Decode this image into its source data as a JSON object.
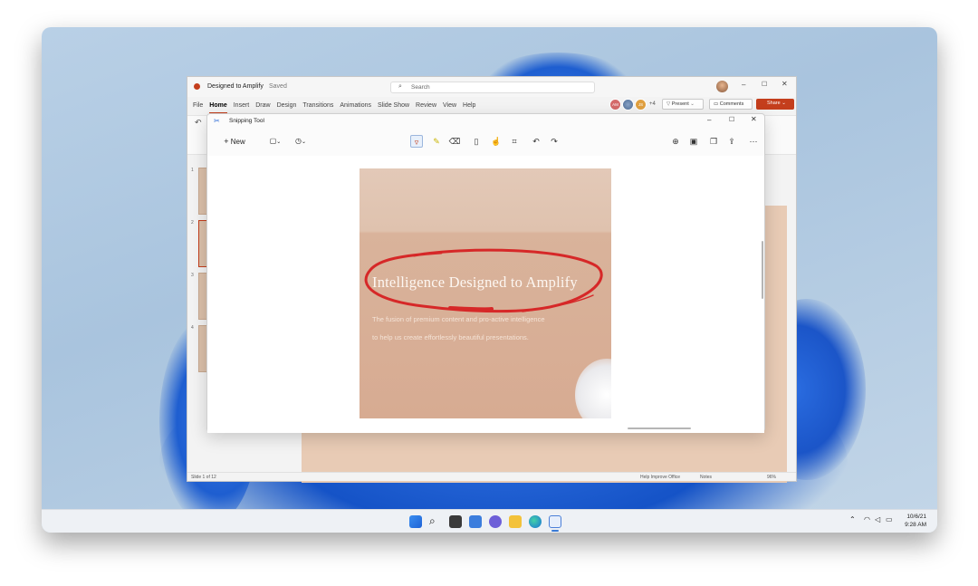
{
  "powerpoint": {
    "doc_title": "Designed to Amplify",
    "saved_status": "Saved",
    "search_placeholder": "Search",
    "menu": [
      "File",
      "Home",
      "Insert",
      "Draw",
      "Design",
      "Transitions",
      "Animations",
      "Slide Show",
      "Review",
      "View",
      "Help"
    ],
    "active_menu": "Home",
    "collaborators": [
      "AM",
      "",
      "JS"
    ],
    "collab_extra": "+4",
    "present_label": "Present",
    "comments_label": "Comments",
    "share_label": "Share",
    "thumb_numbers": [
      "1",
      "2",
      "3",
      "4"
    ],
    "status_left": "Slide 1 of 12",
    "status_help": "Help Improve Office",
    "status_notes": "Notes",
    "zoom": "96%"
  },
  "snipping_tool": {
    "title": "Snipping Tool",
    "new_label": "New",
    "capture": {
      "title": "Intelligence Designed to Amplify",
      "line1": "The fusion of premium content and pro-active intelligence",
      "line2": "to help us create effortlessly beautiful presentations."
    }
  },
  "taskbar": {
    "date": "10/6/21",
    "time": "9:28 AM"
  },
  "colors": {
    "accent": "#c43e1c",
    "ink": "#d62828"
  }
}
